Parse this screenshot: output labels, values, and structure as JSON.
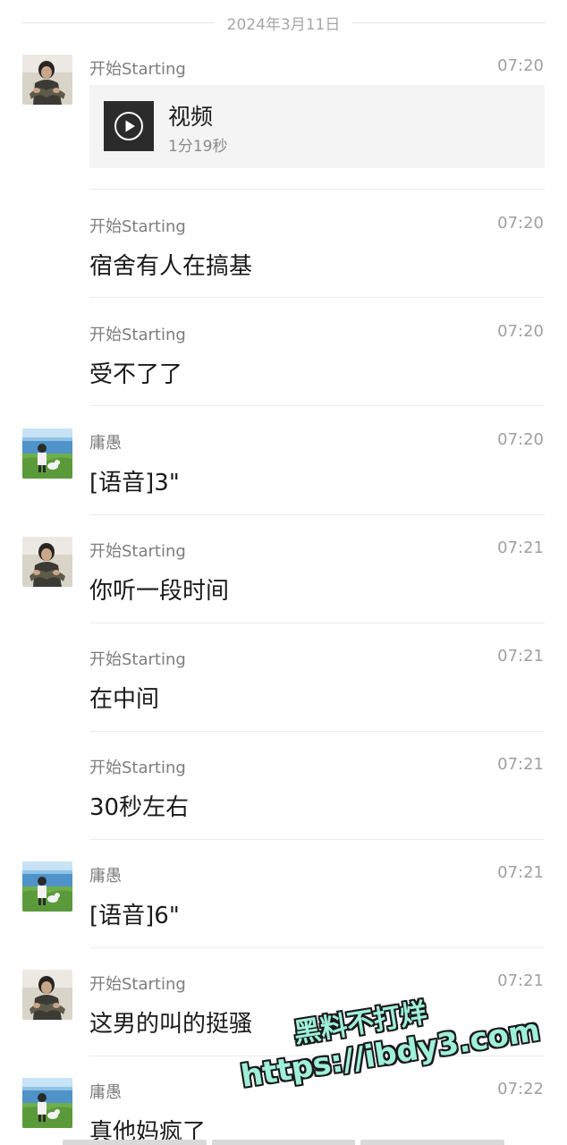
{
  "date_separator": "2024年3月11日",
  "messages": [
    {
      "sender": "开始Starting",
      "time": "07:20",
      "type": "video",
      "video_title": "视频",
      "video_duration": "1分19秒",
      "avatar": "starting"
    },
    {
      "sender": "开始Starting",
      "time": "07:20",
      "type": "text",
      "text": "宿舍有人在搞基",
      "avatar": ""
    },
    {
      "sender": "开始Starting",
      "time": "07:20",
      "type": "text",
      "text": "受不了了",
      "avatar": ""
    },
    {
      "sender": "庸愚",
      "time": "07:20",
      "type": "text",
      "text": "[语音]3\"",
      "avatar": "yongyu"
    },
    {
      "sender": "开始Starting",
      "time": "07:21",
      "type": "text",
      "text": "你听一段时间",
      "avatar": "starting"
    },
    {
      "sender": "开始Starting",
      "time": "07:21",
      "type": "text",
      "text": "在中间",
      "avatar": ""
    },
    {
      "sender": "开始Starting",
      "time": "07:21",
      "type": "text",
      "text": "30秒左右",
      "avatar": ""
    },
    {
      "sender": "庸愚",
      "time": "07:21",
      "type": "text",
      "text": "[语音]6\"",
      "avatar": "yongyu"
    },
    {
      "sender": "开始Starting",
      "time": "07:21",
      "type": "text",
      "text": "这男的叫的挺骚",
      "avatar": "starting"
    },
    {
      "sender": "庸愚",
      "time": "07:22",
      "type": "text",
      "text": "真他妈疯了",
      "avatar": "yongyu"
    }
  ],
  "watermark": {
    "line1": "黑料不打烊",
    "line2": "https://ibdy3.com"
  },
  "icons": {
    "play": "play-circle-icon"
  },
  "colors": {
    "background": "#ffffff",
    "muted_text": "#a0a0a0",
    "video_card": "#f4f4f4",
    "watermark": "#9ff0d9"
  }
}
